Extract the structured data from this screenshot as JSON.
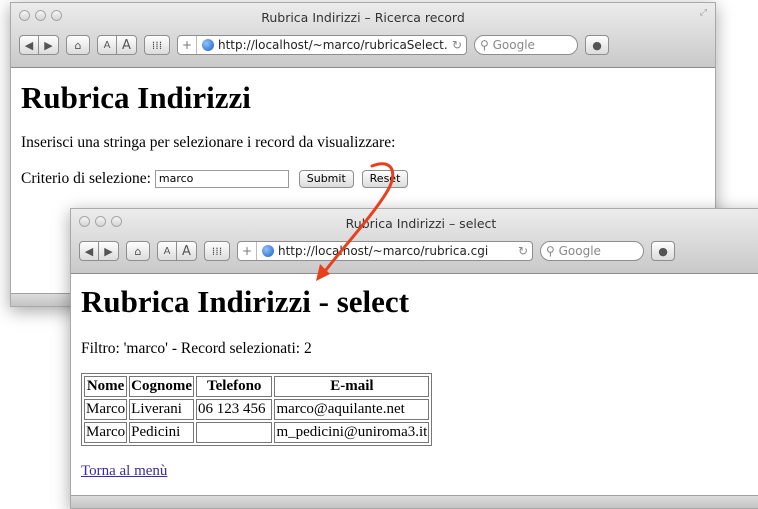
{
  "window1": {
    "title": "Rubrica Indirizzi – Ricerca record",
    "url": "http://localhost/~marco/rubricaSelect.",
    "search_placeholder": "Google",
    "heading": "Rubrica Indirizzi",
    "instruction": "Inserisci una stringa per selezionare i record da visualizzare:",
    "criterion_label": "Criterio di selezione:",
    "criterion_value": "marco",
    "submit_label": "Submit",
    "reset_label": "Reset"
  },
  "window2": {
    "title": "Rubrica Indirizzi – select",
    "url": "http://localhost/~marco/rubrica.cgi",
    "search_placeholder": "Google",
    "heading": "Rubrica Indirizzi - select",
    "filter_text": "Filtro: 'marco' - Record selezionati: 2",
    "columns": [
      "Nome",
      "Cognome",
      "Telefono",
      "E-mail"
    ],
    "rows": [
      [
        "Marco",
        "Liverani",
        "06 123 456",
        "marco@aquilante.net"
      ],
      [
        "Marco",
        "Pedicini",
        "",
        "m_pedicini@uniroma3.it"
      ]
    ],
    "back_link": "Torna al menù"
  },
  "toolbar": {
    "back_icon": "◀",
    "forward_icon": "▶",
    "home_icon": "home-icon",
    "font_small": "A",
    "font_large": "A",
    "reload_icon": "↻"
  },
  "colors": {
    "arrow": "#e8401c",
    "link": "#3b2ba0"
  }
}
